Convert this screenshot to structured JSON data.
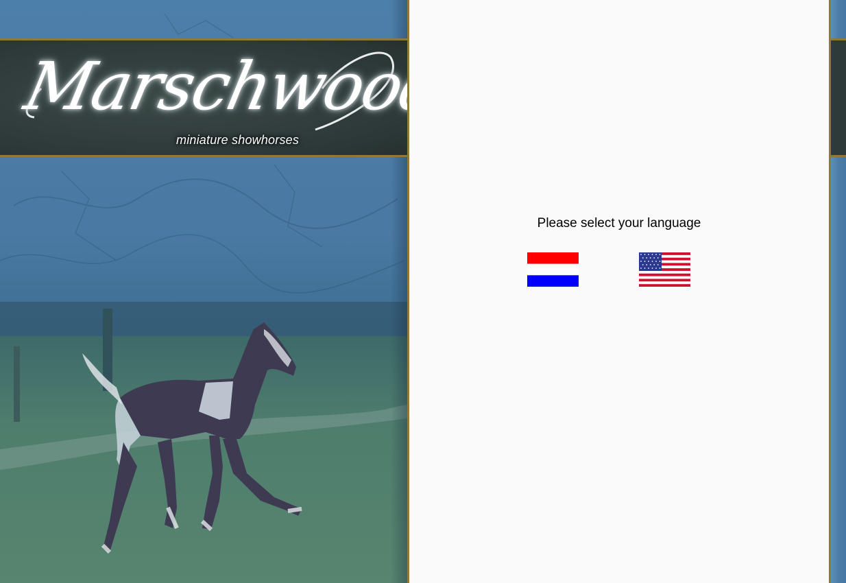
{
  "brand": {
    "logo_text": "Marschwood",
    "subtitle": "miniature showhorses"
  },
  "language_selector": {
    "prompt": "Please select your language",
    "options": [
      {
        "name": "Dutch",
        "flag": "netherlands-flag-icon"
      },
      {
        "name": "English",
        "flag": "usa-flag-icon"
      }
    ]
  },
  "colors": {
    "gold_border": "#8f7a3a",
    "banner_dark": "#2e3a3a",
    "background_blue": "#4a7aa5",
    "panel_white": "#fafafa"
  }
}
